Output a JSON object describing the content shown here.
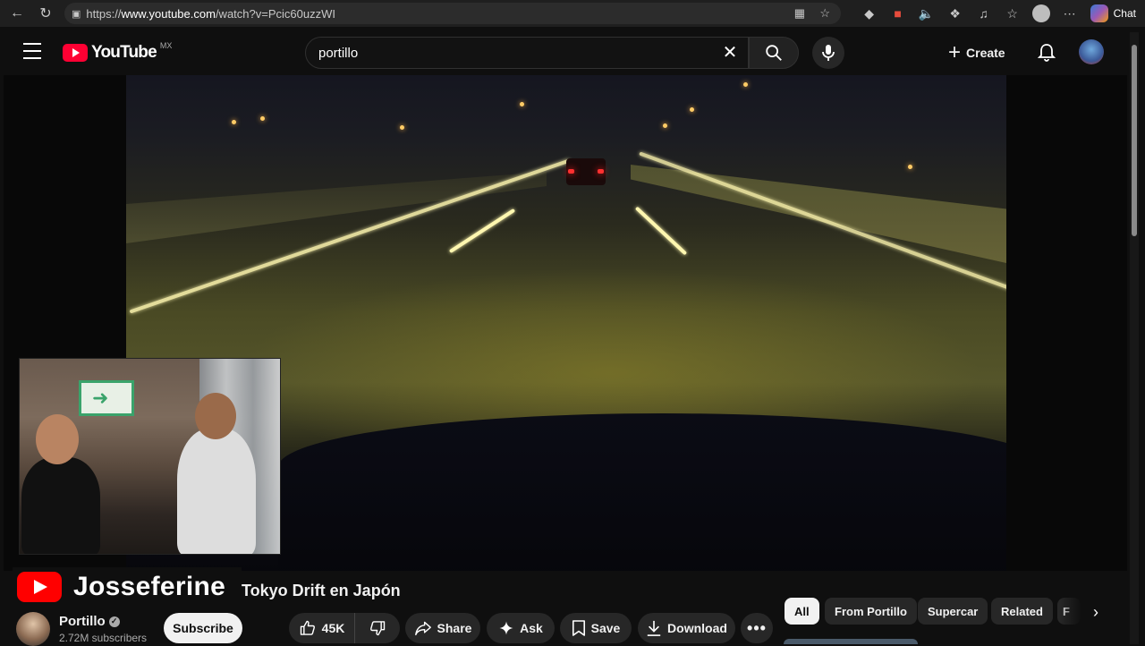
{
  "browser": {
    "url_prefix": "https://",
    "url_domain": "www.youtube.com",
    "url_path": "/watch?v=Pcic60uzzWI",
    "chat_label": "Chat"
  },
  "header": {
    "logo_text": "YouTube",
    "country": "MX",
    "search_value": "portillo",
    "create_label": "Create"
  },
  "overlay": {
    "brand_name": "Josseferine"
  },
  "video": {
    "title_visible": "Tokyo Drift en Japón"
  },
  "channel": {
    "name": "Portillo",
    "subscribers": "2.72M subscribers",
    "subscribe_label": "Subscribe"
  },
  "actions": {
    "likes": "45K",
    "share": "Share",
    "ask": "Ask",
    "save": "Save",
    "download": "Download"
  },
  "chips": [
    "All",
    "From Portillo",
    "Supercar",
    "Related",
    "F"
  ],
  "colors": {
    "brand_red": "#ff0033",
    "background": "#0f0f0f",
    "pill": "#272727"
  }
}
